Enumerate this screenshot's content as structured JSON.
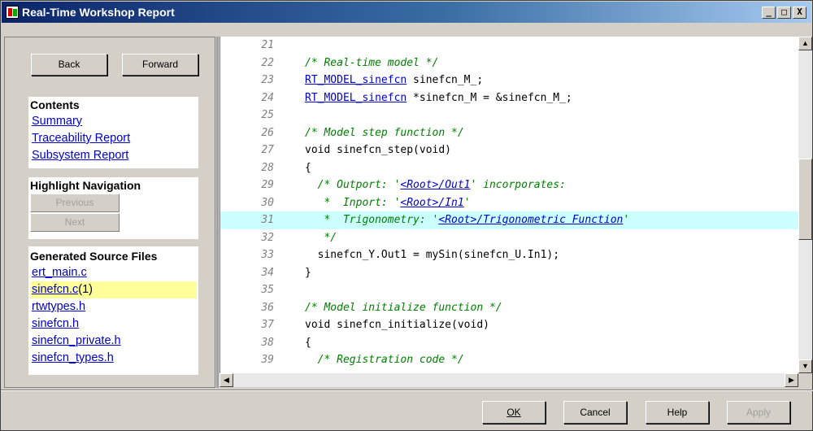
{
  "window": {
    "title": "Real-Time Workshop Report"
  },
  "title_buttons": {
    "minimize": "_",
    "maximize": "□",
    "close": "X"
  },
  "nav": {
    "back_label": "Back",
    "forward_label": "Forward"
  },
  "contents": {
    "heading": "Contents",
    "links": [
      "Summary",
      "Traceability Report",
      "Subsystem Report"
    ]
  },
  "highlight_nav": {
    "heading": "Highlight Navigation",
    "previous_label": "Previous",
    "next_label": "Next"
  },
  "source_files": {
    "heading": "Generated Source Files",
    "files": [
      {
        "name": "ert_main.c",
        "count": ""
      },
      {
        "name": "sinefcn.c",
        "count": " (1)"
      },
      {
        "name": "rtwtypes.h",
        "count": ""
      },
      {
        "name": "sinefcn.h",
        "count": ""
      },
      {
        "name": "sinefcn_private.h",
        "count": ""
      },
      {
        "name": "sinefcn_types.h",
        "count": ""
      }
    ]
  },
  "code": [
    {
      "n": "21",
      "parts": []
    },
    {
      "n": "22",
      "parts": [
        {
          "t": "/* Real-time model */",
          "c": "cm"
        }
      ]
    },
    {
      "n": "23",
      "parts": [
        {
          "t": "RT_MODEL_sinefcn",
          "c": "u"
        },
        {
          "t": " sinefcn_M_;",
          "c": ""
        }
      ]
    },
    {
      "n": "24",
      "parts": [
        {
          "t": "RT_MODEL_sinefcn",
          "c": "u"
        },
        {
          "t": " *sinefcn_M = &sinefcn_M_;",
          "c": ""
        }
      ]
    },
    {
      "n": "25",
      "parts": []
    },
    {
      "n": "26",
      "parts": [
        {
          "t": "/* Model step function */",
          "c": "cm"
        }
      ]
    },
    {
      "n": "27",
      "parts": [
        {
          "t": "void sinefcn_step(void)",
          "c": ""
        }
      ]
    },
    {
      "n": "28",
      "parts": [
        {
          "t": "{",
          "c": ""
        }
      ]
    },
    {
      "n": "29",
      "parts": [
        {
          "t": "  /* Outport: '",
          "c": "cm"
        },
        {
          "t": "<Root>/Out1",
          "c": "cm u"
        },
        {
          "t": "' incorporates:",
          "c": "cm"
        }
      ]
    },
    {
      "n": "30",
      "parts": [
        {
          "t": "   *  Inport: '",
          "c": "cm"
        },
        {
          "t": "<Root>/In1",
          "c": "cm u"
        },
        {
          "t": "'",
          "c": "cm"
        }
      ]
    },
    {
      "n": "31",
      "parts": [
        {
          "t": "   *  Trigonometry: '",
          "c": "cm"
        },
        {
          "t": "<Root>/Trigonometric Function",
          "c": "cm u"
        },
        {
          "t": "'",
          "c": "cm"
        }
      ],
      "hl": true
    },
    {
      "n": "32",
      "parts": [
        {
          "t": "   */",
          "c": "cm"
        }
      ]
    },
    {
      "n": "33",
      "parts": [
        {
          "t": "  sinefcn_Y.Out1 = mySin(sinefcn_U.In1);",
          "c": ""
        }
      ]
    },
    {
      "n": "34",
      "parts": [
        {
          "t": "}",
          "c": ""
        }
      ]
    },
    {
      "n": "35",
      "parts": []
    },
    {
      "n": "36",
      "parts": [
        {
          "t": "/* Model initialize function */",
          "c": "cm"
        }
      ]
    },
    {
      "n": "37",
      "parts": [
        {
          "t": "void sinefcn_initialize(void)",
          "c": ""
        }
      ]
    },
    {
      "n": "38",
      "parts": [
        {
          "t": "{",
          "c": ""
        }
      ]
    },
    {
      "n": "39",
      "parts": [
        {
          "t": "  /* Registration code */",
          "c": "cm"
        }
      ]
    }
  ],
  "dialog_buttons": {
    "ok": "OK",
    "cancel": "Cancel",
    "help": "Help",
    "apply": "Apply"
  },
  "colors": {
    "title_start": "#0a246a",
    "link": "#0000cc",
    "comment": "#008000",
    "highlight_line": "#ccffff",
    "highlight_file": "#ffff99"
  }
}
